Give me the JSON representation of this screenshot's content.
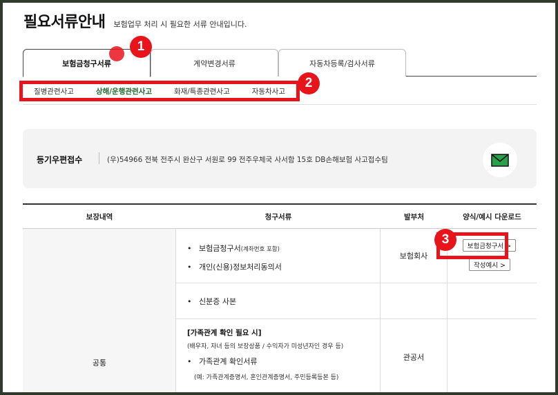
{
  "header": {
    "title": "필요서류안내",
    "subtitle": "보험업무 처리 시 필요한 서류 안내입니다."
  },
  "tabs": [
    {
      "label": "보험금청구서류",
      "active": true
    },
    {
      "label": "계약변경서류",
      "active": false
    },
    {
      "label": "자동차등록/검사서류",
      "active": false
    }
  ],
  "subtabs": [
    {
      "label": "질병관련사고",
      "active": false
    },
    {
      "label": "상해/운행관련사고",
      "active": true
    },
    {
      "label": "화재/특종관련사고",
      "active": false
    },
    {
      "label": "자동차사고",
      "active": false
    }
  ],
  "markers": [
    "1",
    "2",
    "3"
  ],
  "mail": {
    "label": "등기우편접수",
    "address": "(우)54966 전북 전주시 완산구 서원로 99 전주우체국 사서함 15호 DB손해보험 사고접수팀",
    "icon": "envelope-icon"
  },
  "table": {
    "headers": [
      "보장내역",
      "청구서류",
      "발부처",
      "양식/예시 다운로드"
    ],
    "coverage": "공통",
    "rows": [
      {
        "docs": [
          {
            "text": "보험금청구서",
            "note": "(계좌번호 포함)"
          },
          {
            "text": "개인(신용)정보처리동의서",
            "note": ""
          }
        ],
        "issuer": "보험회사",
        "buttons": [
          "보험금청구서 >",
          "작성예시 >"
        ]
      },
      {
        "docs": [
          {
            "text": "신분증 사본",
            "note": ""
          }
        ],
        "issuer": "",
        "buttons": []
      },
      {
        "title": "[가족관계 확인 필요 시]",
        "subnote": "(배우자, 자녀 등의 보장상품 / 수익자가 미성년자인 경우 등)",
        "docs": [
          {
            "text": "가족관계 확인서류",
            "note": ""
          }
        ],
        "example": "(예: 가족관계증명서, 혼인관계증명서, 주민등록등본 등)",
        "issuer": "관공서",
        "buttons": []
      }
    ]
  },
  "colors": {
    "accent_red": "#e8141b",
    "active_green": "#1a6b2a",
    "mail_icon": "#1f8a3c"
  }
}
